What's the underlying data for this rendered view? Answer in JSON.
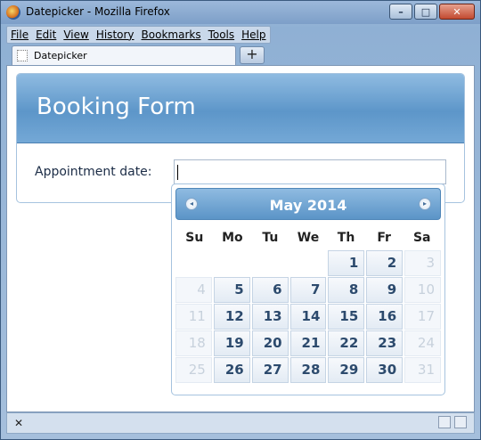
{
  "window": {
    "title": "Datepicker - Mozilla Firefox",
    "minimize": "–",
    "maximize": "□",
    "close": "✕"
  },
  "menu": [
    "File",
    "Edit",
    "View",
    "History",
    "Bookmarks",
    "Tools",
    "Help"
  ],
  "tab": {
    "label": "Datepicker",
    "new_tab": "+"
  },
  "form": {
    "title": "Booking Form",
    "appointment_label": "Appointment date:",
    "appointment_value": ""
  },
  "datepicker": {
    "month_label": "May 2014",
    "prev_icon": "◂",
    "next_icon": "▸",
    "weekdays": [
      "Su",
      "Mo",
      "Tu",
      "We",
      "Th",
      "Fr",
      "Sa"
    ],
    "weeks": [
      [
        "",
        "",
        "",
        "",
        "1",
        "2",
        "3"
      ],
      [
        "4",
        "5",
        "6",
        "7",
        "8",
        "9",
        "10"
      ],
      [
        "11",
        "12",
        "13",
        "14",
        "15",
        "16",
        "17"
      ],
      [
        "18",
        "19",
        "20",
        "21",
        "22",
        "23",
        "24"
      ],
      [
        "25",
        "26",
        "27",
        "28",
        "29",
        "30",
        "31"
      ]
    ],
    "disabled": [
      [
        false,
        false,
        false,
        false,
        false,
        false,
        true
      ],
      [
        true,
        false,
        false,
        false,
        false,
        false,
        true
      ],
      [
        true,
        false,
        false,
        false,
        false,
        false,
        true
      ],
      [
        true,
        false,
        false,
        false,
        false,
        false,
        true
      ],
      [
        true,
        false,
        false,
        false,
        false,
        false,
        true
      ]
    ]
  },
  "status": {
    "close_label": "✕"
  }
}
